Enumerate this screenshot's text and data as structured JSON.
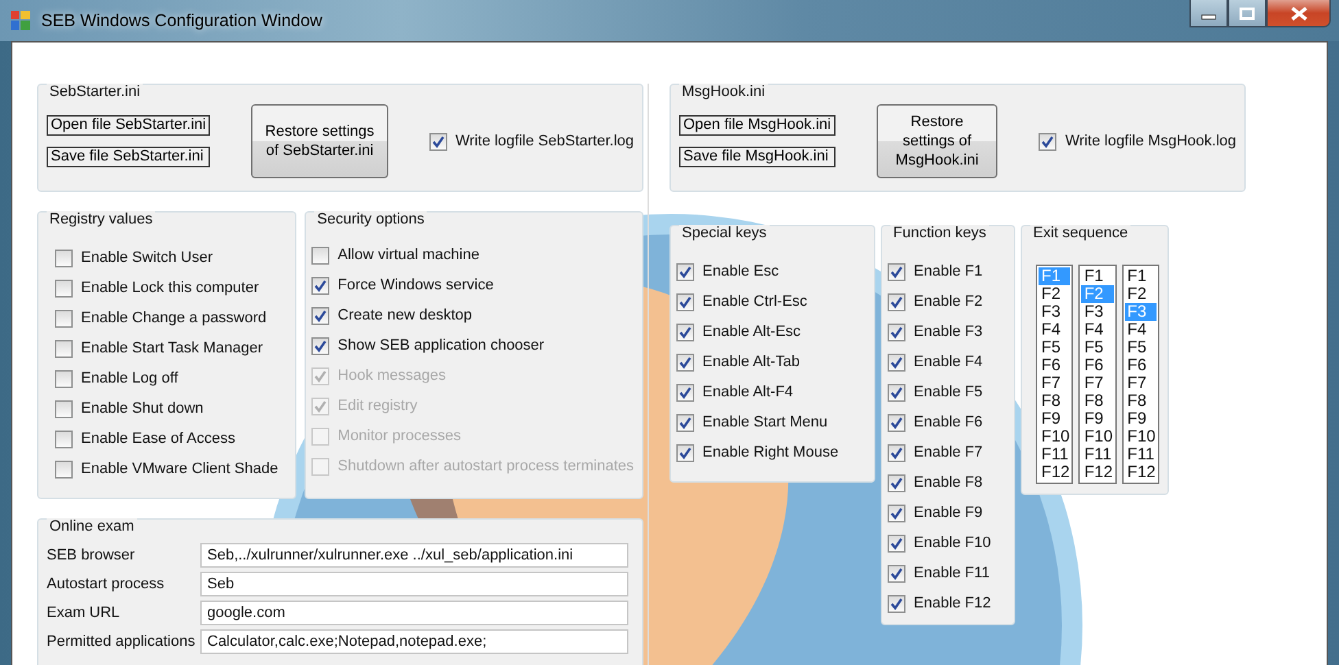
{
  "window": {
    "title": "SEB Windows Configuration Window"
  },
  "sebstarter": {
    "title": "SebStarter.ini",
    "open_button": "Open file SebStarter.ini",
    "save_button": "Save file SebStarter.ini",
    "restore_button": "Restore settings of SebStarter.ini",
    "logfile": {
      "label": "Write logfile SebStarter.log",
      "checked": true
    }
  },
  "registry_values": {
    "title": "Registry values",
    "items": [
      {
        "label": "Enable Switch User",
        "checked": false
      },
      {
        "label": "Enable Lock this computer",
        "checked": false
      },
      {
        "label": "Enable Change a password",
        "checked": false
      },
      {
        "label": "Enable Start Task Manager",
        "checked": false
      },
      {
        "label": "Enable Log off",
        "checked": false
      },
      {
        "label": "Enable Shut down",
        "checked": false
      },
      {
        "label": "Enable Ease of Access",
        "checked": false
      },
      {
        "label": "Enable VMware Client Shade",
        "checked": false
      }
    ]
  },
  "security_options": {
    "title": "Security options",
    "items": [
      {
        "label": "Allow virtual machine",
        "checked": false,
        "disabled": false
      },
      {
        "label": "Force Windows service",
        "checked": true,
        "disabled": false
      },
      {
        "label": "Create new desktop",
        "checked": true,
        "disabled": false
      },
      {
        "label": "Show SEB application chooser",
        "checked": true,
        "disabled": false
      },
      {
        "label": "Hook messages",
        "checked": true,
        "disabled": true
      },
      {
        "label": "Edit registry",
        "checked": true,
        "disabled": true
      },
      {
        "label": "Monitor processes",
        "checked": false,
        "disabled": true
      },
      {
        "label": "Shutdown after autostart process terminates",
        "checked": false,
        "disabled": true
      }
    ]
  },
  "online_exam": {
    "title": "Online exam",
    "fields": [
      {
        "label": "SEB browser",
        "value": "Seb,../xulrunner/xulrunner.exe ../xul_seb/application.ini"
      },
      {
        "label": "Autostart process",
        "value": "Seb"
      },
      {
        "label": "Exam URL",
        "value": "google.com"
      },
      {
        "label": "Permitted applications",
        "value": "Calculator,calc.exe;Notepad,notepad.exe;"
      }
    ]
  },
  "msghook": {
    "title": "MsgHook.ini",
    "open_button": "Open file MsgHook.ini",
    "save_button": "Save file MsgHook.ini",
    "restore_button": "Restore settings of MsgHook.ini",
    "logfile": {
      "label": "Write logfile MsgHook.log",
      "checked": true
    }
  },
  "special_keys": {
    "title": "Special keys",
    "items": [
      {
        "label": "Enable Esc",
        "checked": true
      },
      {
        "label": "Enable Ctrl-Esc",
        "checked": true
      },
      {
        "label": "Enable Alt-Esc",
        "checked": true
      },
      {
        "label": "Enable Alt-Tab",
        "checked": true
      },
      {
        "label": "Enable Alt-F4",
        "checked": true
      },
      {
        "label": "Enable Start Menu",
        "checked": true
      },
      {
        "label": "Enable Right Mouse",
        "checked": true
      }
    ]
  },
  "function_keys": {
    "title": "Function keys",
    "items": [
      {
        "label": "Enable F1",
        "checked": true
      },
      {
        "label": "Enable F2",
        "checked": true
      },
      {
        "label": "Enable F3",
        "checked": true
      },
      {
        "label": "Enable F4",
        "checked": true
      },
      {
        "label": "Enable F5",
        "checked": true
      },
      {
        "label": "Enable F6",
        "checked": true
      },
      {
        "label": "Enable F7",
        "checked": true
      },
      {
        "label": "Enable F8",
        "checked": true
      },
      {
        "label": "Enable F9",
        "checked": true
      },
      {
        "label": "Enable F10",
        "checked": true
      },
      {
        "label": "Enable F11",
        "checked": true
      },
      {
        "label": "Enable F12",
        "checked": true
      }
    ]
  },
  "exit_sequence": {
    "title": "Exit sequence",
    "lists": [
      {
        "items": [
          {
            "label": "F1",
            "selected": true
          },
          {
            "label": "F2",
            "selected": false
          },
          {
            "label": "F3",
            "selected": false
          },
          {
            "label": "F4",
            "selected": false
          },
          {
            "label": "F5",
            "selected": false
          },
          {
            "label": "F6",
            "selected": false
          },
          {
            "label": "F7",
            "selected": false
          },
          {
            "label": "F8",
            "selected": false
          },
          {
            "label": "F9",
            "selected": false
          },
          {
            "label": "F10",
            "selected": false
          },
          {
            "label": "F11",
            "selected": false
          },
          {
            "label": "F12",
            "selected": false
          }
        ]
      },
      {
        "items": [
          {
            "label": "F1",
            "selected": false
          },
          {
            "label": "F2",
            "selected": true
          },
          {
            "label": "F3",
            "selected": false
          },
          {
            "label": "F4",
            "selected": false
          },
          {
            "label": "F5",
            "selected": false
          },
          {
            "label": "F6",
            "selected": false
          },
          {
            "label": "F7",
            "selected": false
          },
          {
            "label": "F8",
            "selected": false
          },
          {
            "label": "F9",
            "selected": false
          },
          {
            "label": "F10",
            "selected": false
          },
          {
            "label": "F11",
            "selected": false
          },
          {
            "label": "F12",
            "selected": false
          }
        ]
      },
      {
        "items": [
          {
            "label": "F1",
            "selected": false
          },
          {
            "label": "F2",
            "selected": false
          },
          {
            "label": "F3",
            "selected": true
          },
          {
            "label": "F4",
            "selected": false
          },
          {
            "label": "F5",
            "selected": false
          },
          {
            "label": "F6",
            "selected": false
          },
          {
            "label": "F7",
            "selected": false
          },
          {
            "label": "F8",
            "selected": false
          },
          {
            "label": "F9",
            "selected": false
          },
          {
            "label": "F10",
            "selected": false
          },
          {
            "label": "F11",
            "selected": false
          },
          {
            "label": "F12",
            "selected": false
          }
        ]
      }
    ]
  }
}
